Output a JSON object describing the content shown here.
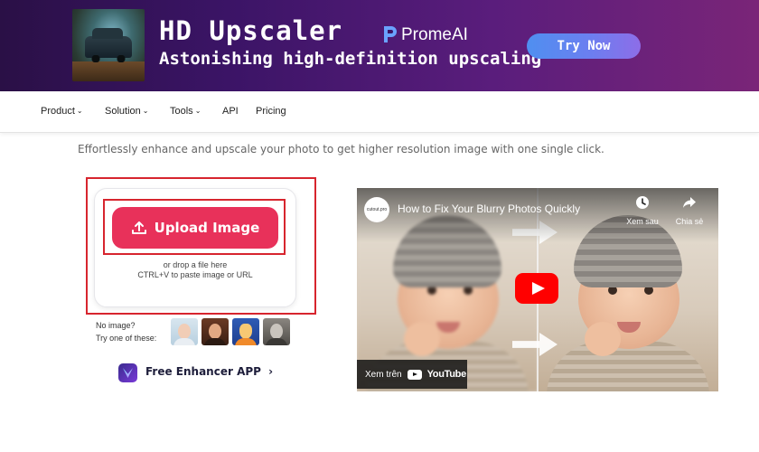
{
  "banner": {
    "title": "HD Upscaler",
    "subtitle": "Astonishing high-definition upscaling",
    "brand": "PromeAI",
    "cta_label": "Try Now",
    "brand_colors": {
      "gradient_start": "#2a1046",
      "gradient_end": "#7a2578",
      "cta": "#5f87f0"
    }
  },
  "nav": {
    "items": [
      {
        "label": "Product",
        "dropdown": true
      },
      {
        "label": "Solution",
        "dropdown": true
      },
      {
        "label": "Tools",
        "dropdown": true
      },
      {
        "label": "API",
        "dropdown": false
      },
      {
        "label": "Pricing",
        "dropdown": false
      }
    ],
    "chevron": "⌄"
  },
  "main": {
    "tagline": "Effortlessly enhance and upscale your photo to get higher resolution image with one single click.",
    "upload": {
      "button_label": "Upload Image",
      "drop_hint": "or drop a file here",
      "paste_hint": "CTRL+V to paste image or URL",
      "accent_color": "#e8315a",
      "highlight_color": "#d7252e"
    },
    "samples": {
      "line1": "No image?",
      "line2": "Try one of these:",
      "icons": [
        "sample-portrait-icon",
        "sample-woman-icon",
        "sample-anime-icon",
        "sample-bw-portrait-icon"
      ]
    },
    "app_link": {
      "label": "Free Enhancer APP",
      "arrow": "›"
    }
  },
  "video": {
    "channel": "cutout.pro",
    "title": "How to Fix Your Blurry Photos Quickly",
    "watch_later": "Xem sau",
    "share": "Chia sẻ",
    "watch_on": "Xem trên",
    "platform": "YouTube"
  }
}
